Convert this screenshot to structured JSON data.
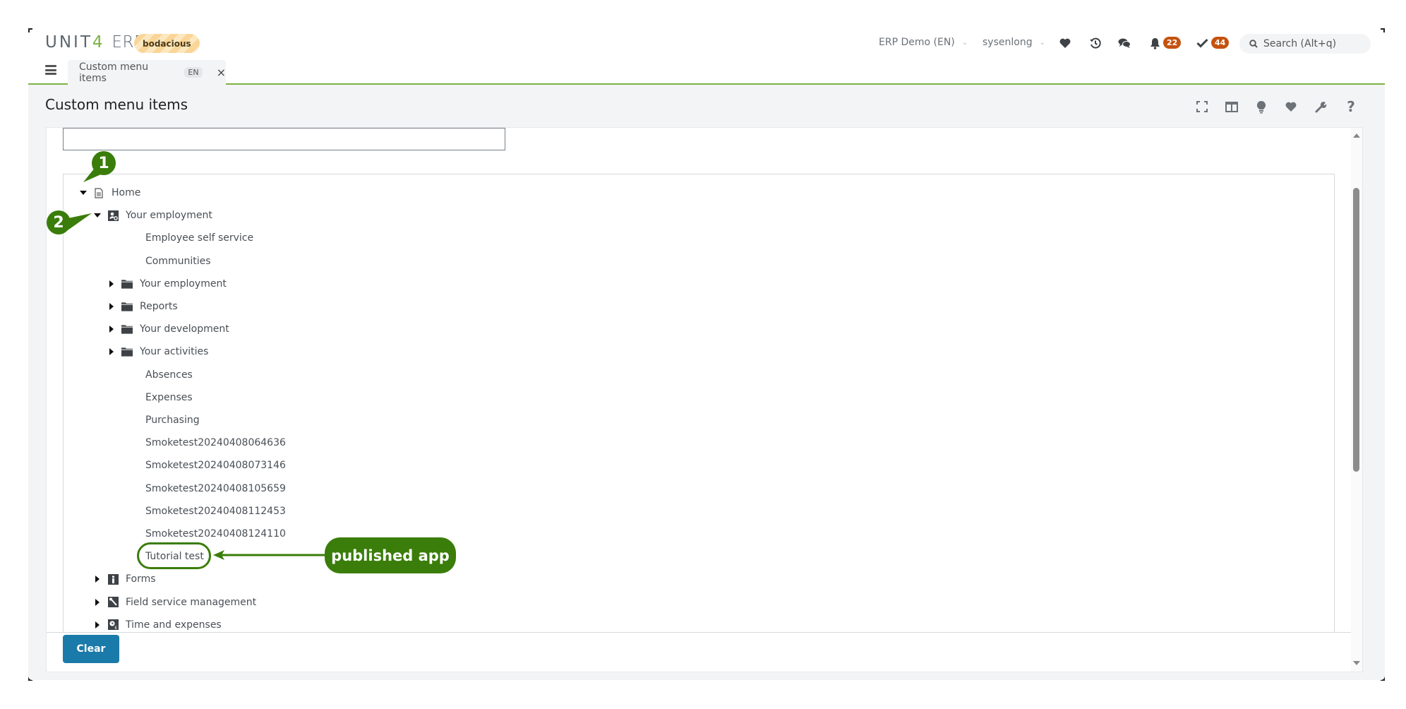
{
  "header": {
    "brand": "UNIT",
    "brand_digit": "4",
    "product": "ERP",
    "environment_tag": "bodacious",
    "company_select": "ERP Demo (EN)",
    "user_select": "sysenlong",
    "notifications_count": "22",
    "tasks_count": "44",
    "search_placeholder": "Search (Alt+q)",
    "icons": [
      "heart-icon",
      "history-icon",
      "chat-icon",
      "bell-icon",
      "check-icon",
      "search-icon"
    ]
  },
  "tabs": [
    {
      "label": "Custom menu items",
      "lang": "EN",
      "active": true
    }
  ],
  "page": {
    "title": "Custom menu items",
    "toolbar_icons": [
      "fullscreen-icon",
      "split-view-icon",
      "lightbulb-icon",
      "favorite-icon",
      "wrench-icon",
      "help-icon"
    ],
    "filter_value": ""
  },
  "tree": [
    {
      "label": "Home",
      "level": 0,
      "state": "expanded",
      "icon": "document-icon"
    },
    {
      "label": "Your employment",
      "level": 1,
      "state": "expanded",
      "icon": "employee-settings-icon"
    },
    {
      "label": "Employee self service",
      "level": 2,
      "state": "leaf",
      "icon": ""
    },
    {
      "label": "Communities",
      "level": 2,
      "state": "leaf",
      "icon": ""
    },
    {
      "label": "Your employment",
      "level": 2,
      "state": "collapsed",
      "icon": "folder-icon"
    },
    {
      "label": "Reports",
      "level": 2,
      "state": "collapsed",
      "icon": "folder-icon"
    },
    {
      "label": "Your development",
      "level": 2,
      "state": "collapsed",
      "icon": "folder-icon"
    },
    {
      "label": "Your activities",
      "level": 2,
      "state": "collapsed",
      "icon": "folder-icon"
    },
    {
      "label": "Absences",
      "level": 2,
      "state": "leaf",
      "icon": ""
    },
    {
      "label": "Expenses",
      "level": 2,
      "state": "leaf",
      "icon": ""
    },
    {
      "label": "Purchasing",
      "level": 2,
      "state": "leaf",
      "icon": ""
    },
    {
      "label": "Smoketest20240408064636",
      "level": 2,
      "state": "leaf",
      "icon": ""
    },
    {
      "label": "Smoketest20240408073146",
      "level": 2,
      "state": "leaf",
      "icon": ""
    },
    {
      "label": "Smoketest20240408105659",
      "level": 2,
      "state": "leaf",
      "icon": ""
    },
    {
      "label": "Smoketest20240408112453",
      "level": 2,
      "state": "leaf",
      "icon": ""
    },
    {
      "label": "Smoketest20240408124110",
      "level": 2,
      "state": "leaf",
      "icon": ""
    },
    {
      "label": "Tutorial test",
      "level": 2,
      "state": "leaf",
      "icon": ""
    },
    {
      "label": "Forms",
      "level": 1,
      "state": "collapsed",
      "icon": "info-icon"
    },
    {
      "label": "Field service management",
      "level": 1,
      "state": "collapsed",
      "icon": "wrench-icon"
    },
    {
      "label": "Time and expenses",
      "level": 1,
      "state": "collapsed",
      "icon": "time-expense-icon"
    }
  ],
  "footer": {
    "clear_label": "Clear"
  },
  "annotations": {
    "callout_1": "1",
    "callout_2": "2",
    "published_label": "published app",
    "accent_color": "#3a7d0a"
  },
  "colors": {
    "brand_green": "#7cb342",
    "badge_orange": "#c4520e",
    "primary_button": "#1a7aaa"
  }
}
